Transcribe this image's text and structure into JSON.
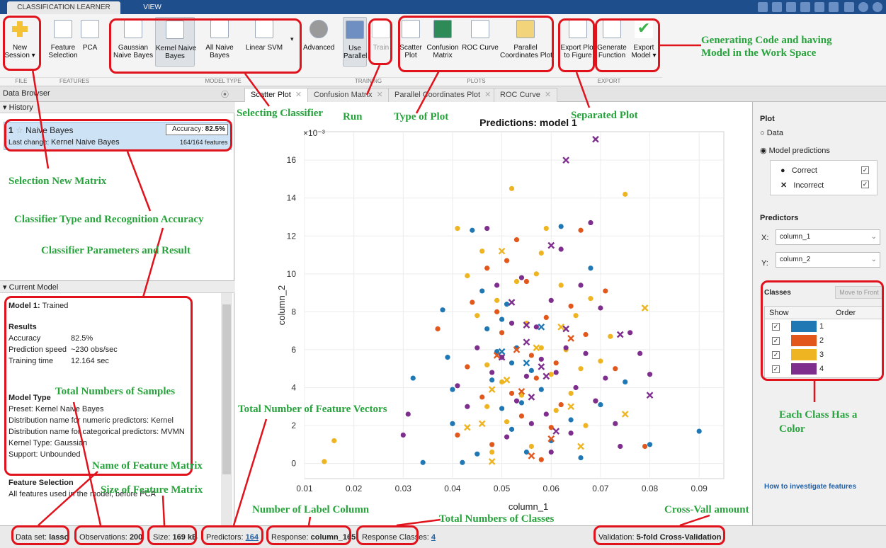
{
  "tabs": {
    "app": "CLASSIFICATION LEARNER",
    "view": "VIEW"
  },
  "ribbon": {
    "new_session": "New\nSession ▾",
    "feature_selection": "Feature\nSelection",
    "pca": "PCA",
    "gaussian": "Gaussian\nNaive Bayes",
    "kernel": "Kernel Naive\nBayes",
    "allnb": "All Naive\nBayes",
    "svm": "Linear SVM",
    "advanced": "Advanced",
    "parallel": "Use\nParallel",
    "train": "Train",
    "scatter": "Scatter\nPlot",
    "confusion": "Confusion\nMatrix",
    "roc": "ROC Curve",
    "pcp": "Parallel\nCoordinates Plot",
    "export_plot": "Export Plot\nto Figure",
    "generate": "Generate\nFunction",
    "export_model": "Export\nModel ▾",
    "groups": {
      "file": "FILE",
      "features": "FEATURES",
      "model_type": "MODEL TYPE",
      "training": "TRAINING",
      "plots": "PLOTS",
      "export": "EXPORT"
    }
  },
  "doc_tabs": [
    "Scatter Plot",
    "Confusion Matrix",
    "Parallel Coordinates Plot",
    "ROC Curve"
  ],
  "data_browser": "Data Browser",
  "history": {
    "title": "▾ History",
    "num": "1",
    "name": "Naive Bayes",
    "acc_label": "Accuracy:",
    "acc": "82.5%",
    "last_change_label": "Last change:",
    "last_change": "Kernel Naive Bayes",
    "features": "164/164 features"
  },
  "current_model": {
    "title": "▾ Current Model",
    "model": "Model 1:",
    "status": "Trained",
    "results": "Results",
    "rows": [
      [
        "Accuracy",
        "82.5%"
      ],
      [
        "Prediction speed",
        "~230 obs/sec"
      ],
      [
        "Training time",
        "12.164 sec"
      ]
    ],
    "model_type": "Model Type",
    "type_lines": [
      "Preset: Kernel Naive Bayes",
      "Distribution name for numeric predictors: Kernel",
      "Distribution name for categorical predictors: MVMN",
      "Kernel Type: Gaussian",
      "Support: Unbounded"
    ],
    "feature_selection": "Feature Selection",
    "fs_text": "All features used in the model, before PCA"
  },
  "right": {
    "plot": "Plot",
    "data": "Data",
    "model_predictions": "Model predictions",
    "correct": "Correct",
    "incorrect": "Incorrect",
    "predictors": "Predictors",
    "x_label": "X:",
    "x_val": "column_1",
    "y_label": "Y:",
    "y_val": "column_2",
    "classes": "Classes",
    "move_front": "Move to Front",
    "show": "Show",
    "order": "Order",
    "class_names": [
      "1",
      "2",
      "3",
      "4"
    ],
    "how": "How to investigate features"
  },
  "status": {
    "dataset_label": "Data set:",
    "dataset": "lasso",
    "obs_label": "Observations:",
    "obs": "200",
    "size_label": "Size:",
    "size": "169 kB",
    "pred_label": "Predictors:",
    "pred": "164",
    "resp_label": "Response:",
    "resp": "column_165",
    "rc_label": "Response Classes:",
    "rc": "4",
    "val_label": "Validation:",
    "val": "5-fold Cross-Validation"
  },
  "annotations": {
    "gen_code": "Generating Code and having\nModel in the Work Space",
    "selecting": "Selecting Classifier",
    "run": "Run",
    "type_plot": "Type of Plot",
    "separated": "Separated Plot",
    "new_matrix": "Selection New Matrix",
    "classifier_type": "Classifier Type and Recognition Accuracy",
    "params": "Classifier Parameters and Result",
    "samples": "Total Numbers of Samples",
    "feature_vectors": "Total Number of Feature Vectors",
    "name_fm": "Name of Feature Matrix",
    "size_fm": "Size of Feature Matrix",
    "label_col": "Number of Label Column",
    "num_classes": "Total Numbers of Classes",
    "cross": "Cross-Vall amount",
    "each_class": "Each Class Has a\nColor"
  },
  "colors": {
    "c1": "#1f77b4",
    "c2": "#e2581c",
    "c3": "#eeb422",
    "c4": "#7e2f8e",
    "annot": "#27a33c",
    "box": "#e0131c"
  },
  "chart_data": {
    "type": "scatter",
    "title": "Predictions: model 1",
    "xlabel": "column_1",
    "ylabel": "column_2",
    "y_multiplier": "×10⁻³",
    "xlim": [
      0.01,
      0.095
    ],
    "ylim": [
      -0.8,
      17.5
    ],
    "xticks": [
      "0.01",
      "0.02",
      "0.03",
      "0.04",
      "0.05",
      "0.06",
      "0.07",
      "0.08",
      "0.09"
    ],
    "yticks": [
      "0",
      "2",
      "4",
      "6",
      "8",
      "10",
      "12",
      "14",
      "16"
    ],
    "series": [
      {
        "name": "1",
        "color": "#1f77b4",
        "points": [
          [
            0.034,
            0.05
          ],
          [
            0.032,
            4.5
          ],
          [
            0.038,
            8.1
          ],
          [
            0.039,
            5.6
          ],
          [
            0.04,
            2.1
          ],
          [
            0.04,
            3.9
          ],
          [
            0.042,
            0.05
          ],
          [
            0.044,
            12.3
          ],
          [
            0.046,
            9.1
          ],
          [
            0.047,
            7.1
          ],
          [
            0.048,
            4.4
          ],
          [
            0.049,
            5.9
          ],
          [
            0.05,
            2.9
          ],
          [
            0.051,
            8.4
          ],
          [
            0.052,
            1.8
          ],
          [
            0.053,
            6.1
          ],
          [
            0.054,
            3.2
          ],
          [
            0.055,
            0.6
          ],
          [
            0.056,
            4.9
          ],
          [
            0.058,
            3.9
          ],
          [
            0.06,
            1.2
          ],
          [
            0.062,
            12.5
          ],
          [
            0.064,
            2.3
          ],
          [
            0.066,
            0.3
          ],
          [
            0.068,
            10.3
          ],
          [
            0.07,
            3.1
          ],
          [
            0.075,
            4.3
          ],
          [
            0.08,
            1.0
          ],
          [
            0.09,
            1.7
          ],
          [
            0.05,
            7.6
          ],
          [
            0.052,
            5.3
          ],
          [
            0.045,
            0.5
          ]
        ]
      },
      {
        "name": "2",
        "color": "#e2581c",
        "points": [
          [
            0.037,
            7.1
          ],
          [
            0.041,
            1.5
          ],
          [
            0.043,
            5.1
          ],
          [
            0.046,
            3.5
          ],
          [
            0.047,
            10.3
          ],
          [
            0.049,
            8.0
          ],
          [
            0.05,
            6.9
          ],
          [
            0.051,
            10.7
          ],
          [
            0.052,
            3.7
          ],
          [
            0.053,
            11.8
          ],
          [
            0.054,
            2.5
          ],
          [
            0.055,
            9.6
          ],
          [
            0.056,
            5.7
          ],
          [
            0.057,
            4.5
          ],
          [
            0.059,
            7.7
          ],
          [
            0.06,
            1.9
          ],
          [
            0.061,
            5.3
          ],
          [
            0.062,
            3.1
          ],
          [
            0.064,
            8.3
          ],
          [
            0.066,
            12.3
          ],
          [
            0.067,
            6.8
          ],
          [
            0.069,
            3.3
          ],
          [
            0.071,
            9.1
          ],
          [
            0.073,
            5.0
          ],
          [
            0.079,
            0.9
          ],
          [
            0.048,
            1.0
          ],
          [
            0.058,
            0.2
          ],
          [
            0.044,
            8.5
          ]
        ]
      },
      {
        "name": "3",
        "color": "#eeb422",
        "points": [
          [
            0.014,
            0.1
          ],
          [
            0.016,
            1.2
          ],
          [
            0.041,
            12.4
          ],
          [
            0.043,
            9.9
          ],
          [
            0.045,
            7.8
          ],
          [
            0.046,
            11.2
          ],
          [
            0.047,
            5.2
          ],
          [
            0.048,
            0.6
          ],
          [
            0.049,
            8.6
          ],
          [
            0.05,
            4.3
          ],
          [
            0.052,
            14.5
          ],
          [
            0.053,
            9.6
          ],
          [
            0.054,
            3.6
          ],
          [
            0.055,
            7.4
          ],
          [
            0.056,
            0.9
          ],
          [
            0.057,
            10.0
          ],
          [
            0.058,
            6.1
          ],
          [
            0.059,
            12.4
          ],
          [
            0.06,
            4.7
          ],
          [
            0.061,
            2.8
          ],
          [
            0.062,
            9.4
          ],
          [
            0.063,
            6.0
          ],
          [
            0.064,
            3.7
          ],
          [
            0.065,
            7.8
          ],
          [
            0.066,
            5.0
          ],
          [
            0.067,
            2.0
          ],
          [
            0.068,
            8.7
          ],
          [
            0.07,
            5.4
          ],
          [
            0.072,
            6.7
          ],
          [
            0.075,
            14.2
          ],
          [
            0.058,
            11.1
          ],
          [
            0.051,
            2.2
          ],
          [
            0.047,
            3.0
          ]
        ]
      },
      {
        "name": "4",
        "color": "#7e2f8e",
        "points": [
          [
            0.03,
            1.5
          ],
          [
            0.031,
            2.6
          ],
          [
            0.041,
            4.1
          ],
          [
            0.043,
            3.0
          ],
          [
            0.045,
            6.1
          ],
          [
            0.047,
            12.4
          ],
          [
            0.048,
            4.8
          ],
          [
            0.049,
            9.4
          ],
          [
            0.05,
            5.6
          ],
          [
            0.051,
            1.4
          ],
          [
            0.052,
            7.4
          ],
          [
            0.053,
            3.3
          ],
          [
            0.054,
            9.8
          ],
          [
            0.055,
            4.6
          ],
          [
            0.056,
            2.1
          ],
          [
            0.057,
            7.2
          ],
          [
            0.058,
            5.5
          ],
          [
            0.059,
            2.6
          ],
          [
            0.06,
            8.6
          ],
          [
            0.061,
            4.8
          ],
          [
            0.062,
            11.3
          ],
          [
            0.063,
            6.1
          ],
          [
            0.064,
            1.6
          ],
          [
            0.065,
            4.0
          ],
          [
            0.066,
            9.4
          ],
          [
            0.067,
            5.8
          ],
          [
            0.068,
            12.7
          ],
          [
            0.069,
            3.3
          ],
          [
            0.07,
            8.2
          ],
          [
            0.071,
            4.5
          ],
          [
            0.073,
            2.1
          ],
          [
            0.074,
            0.9
          ],
          [
            0.076,
            6.9
          ],
          [
            0.078,
            5.8
          ],
          [
            0.08,
            4.7
          ],
          [
            0.06,
            0.6
          ]
        ]
      }
    ],
    "incorrect": [
      {
        "c": "4",
        "p": [
          [
            0.069,
            17.1
          ],
          [
            0.063,
            16.0
          ],
          [
            0.06,
            11.5
          ],
          [
            0.052,
            8.5
          ],
          [
            0.055,
            7.3
          ],
          [
            0.063,
            7.1
          ],
          [
            0.074,
            6.8
          ],
          [
            0.08,
            3.6
          ],
          [
            0.056,
            3.5
          ],
          [
            0.059,
            4.6
          ],
          [
            0.061,
            1.7
          ],
          [
            0.055,
            6.4
          ],
          [
            0.058,
            5.1
          ],
          [
            0.05,
            5.6
          ]
        ]
      },
      {
        "c": "3",
        "p": [
          [
            0.05,
            11.2
          ],
          [
            0.079,
            8.2
          ],
          [
            0.075,
            2.6
          ],
          [
            0.066,
            0.9
          ],
          [
            0.064,
            3.0
          ],
          [
            0.048,
            3.9
          ],
          [
            0.051,
            4.4
          ],
          [
            0.046,
            2.1
          ],
          [
            0.043,
            1.9
          ],
          [
            0.048,
            0.1
          ],
          [
            0.057,
            6.1
          ],
          [
            0.062,
            7.2
          ]
        ]
      },
      {
        "c": "2",
        "p": [
          [
            0.049,
            5.7
          ],
          [
            0.054,
            3.8
          ],
          [
            0.06,
            1.3
          ],
          [
            0.056,
            0.4
          ],
          [
            0.064,
            6.6
          ],
          [
            0.053,
            6.0
          ]
        ]
      },
      {
        "c": "1",
        "p": [
          [
            0.05,
            5.9
          ],
          [
            0.055,
            5.3
          ],
          [
            0.058,
            7.2
          ]
        ]
      }
    ]
  }
}
